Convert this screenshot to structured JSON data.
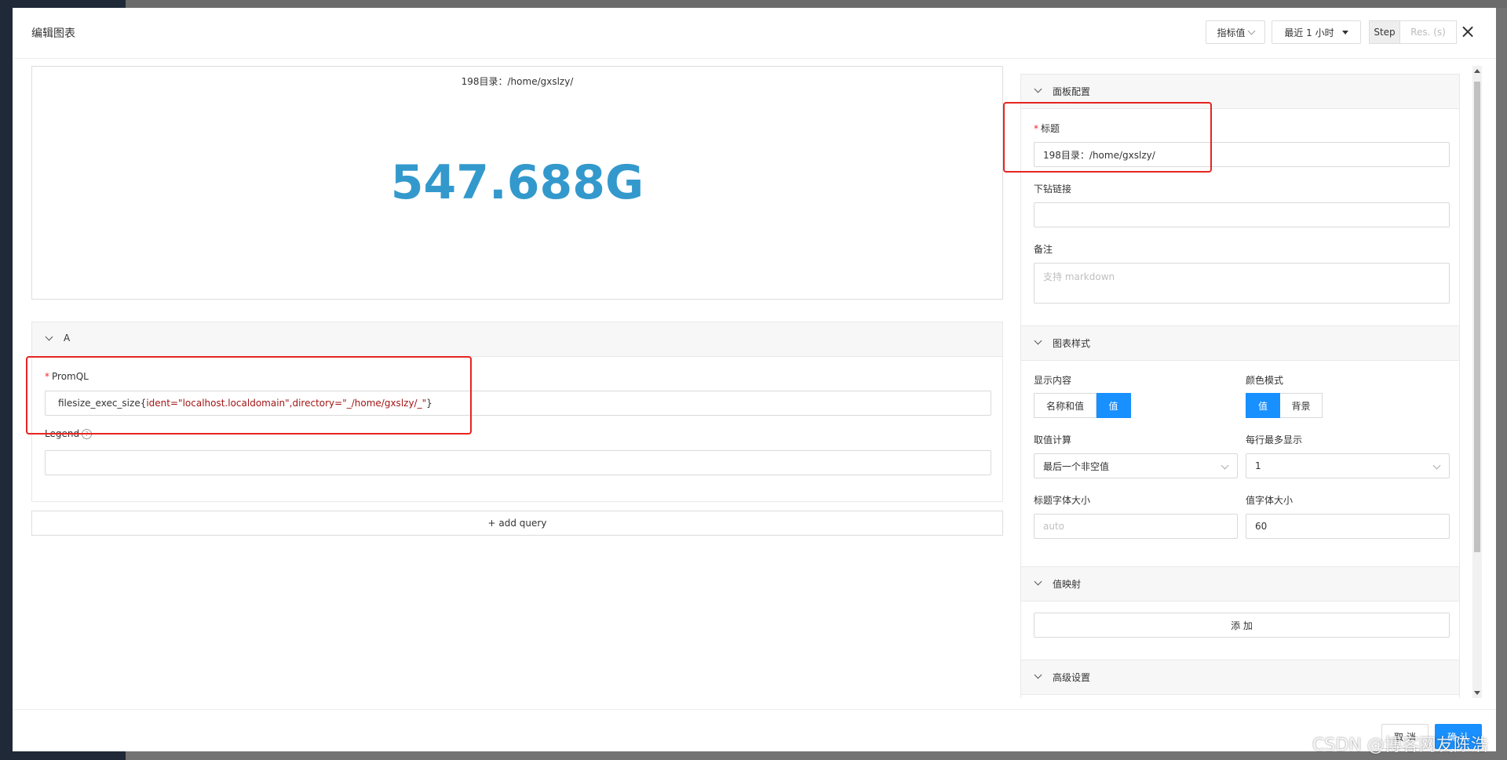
{
  "modal": {
    "title": "编辑图表",
    "metric_btn": "指标值",
    "time_range": "最近 1 小时",
    "step_label": "Step",
    "res_placeholder": "Res. (s)",
    "close_icon": "×"
  },
  "preview": {
    "title": "198目录：/home/gxslzy/",
    "value": "547.688G",
    "value_color": "#3399cc"
  },
  "query": {
    "name": "A",
    "promql_label": "PromQL",
    "promql_prefix": "filesize_exec_size{",
    "promql_args": "ident=\"localhost.localdomain\",directory=\"_/home/gxslzy/_\"",
    "promql_suffix": "}",
    "legend_label": "Legend",
    "legend_value": "",
    "add_query": "+ add query"
  },
  "panel_config": {
    "section_title": "面板配置",
    "title_label": "标题",
    "title_value": "198目录：/home/gxslzy/",
    "drilldown_label": "下钻链接",
    "drilldown_value": "",
    "note_label": "备注",
    "note_placeholder": "支持 markdown"
  },
  "chart_style": {
    "section_title": "图表样式",
    "display_label": "显示内容",
    "display_options": [
      "名称和值",
      "值"
    ],
    "display_selected": "值",
    "color_mode_label": "颜色模式",
    "color_mode_options": [
      "值",
      "背景"
    ],
    "color_mode_selected": "值",
    "calc_label": "取值计算",
    "calc_value": "最后一个非空值",
    "per_row_label": "每行最多显示",
    "per_row_value": "1",
    "title_font_label": "标题字体大小",
    "title_font_placeholder": "auto",
    "value_font_label": "值字体大小",
    "value_font_value": "60"
  },
  "value_mapping": {
    "section_title": "值映射",
    "add_button": "添 加"
  },
  "advanced": {
    "section_title": "高级设置"
  },
  "footer": {
    "cancel": "取 消",
    "confirm": "确 认"
  },
  "watermark": "CSDN @博客网友陈浩",
  "colors": {
    "primary": "#1890ff",
    "annotation_red": "#e52521",
    "value_blue": "#3399cc"
  }
}
